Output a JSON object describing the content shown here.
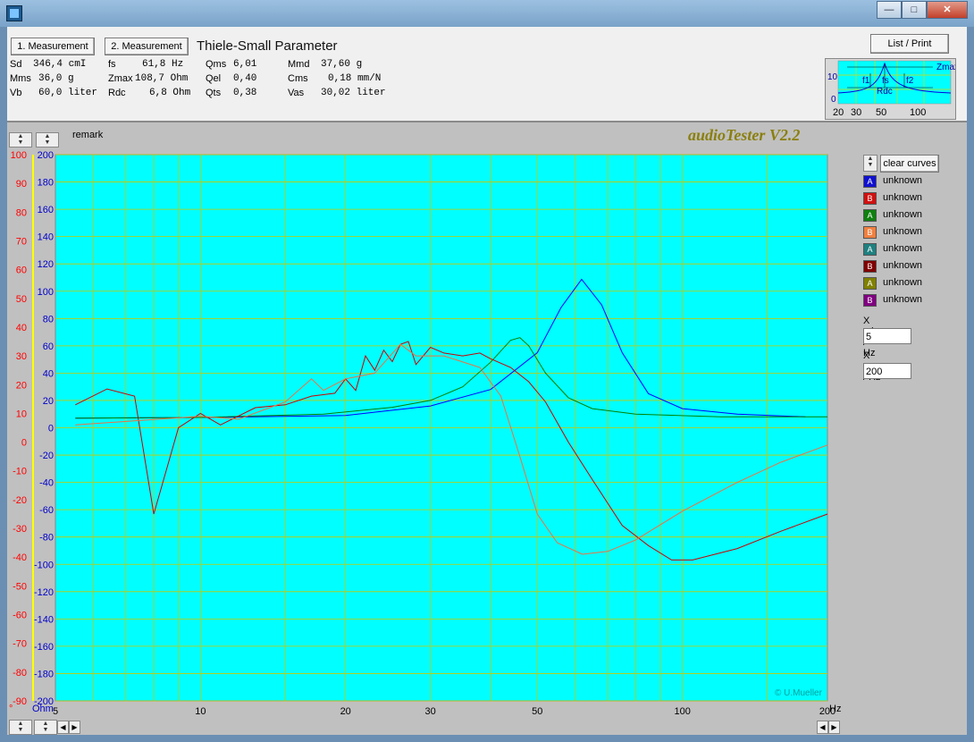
{
  "toolbar": {
    "meas1": "1. Measurement",
    "meas2": "2. Measurement",
    "list_print": "List / Print"
  },
  "tsp_title": "Thiele-Small Parameter",
  "params": [
    {
      "label": "Sd",
      "value": "346,4 cmI"
    },
    {
      "label": "Mms",
      "value": "36,0 g"
    },
    {
      "label": "Vb",
      "value": "60,0 liter"
    },
    {
      "label": "fs",
      "value": "61,8 Hz"
    },
    {
      "label": "Zmax",
      "value": "108,7 Ohm"
    },
    {
      "label": "Rdc",
      "value": "6,8 Ohm"
    },
    {
      "label": "Qms",
      "value": "6,01"
    },
    {
      "label": "Qel",
      "value": "0,40"
    },
    {
      "label": "Qts",
      "value": "0,38"
    },
    {
      "label": "Mmd",
      "value": "37,60 g"
    },
    {
      "label": "Cms",
      "value": "0,18 mm/N"
    },
    {
      "label": "Vas",
      "value": "30,02 liter"
    }
  ],
  "mini_chart": {
    "labels": [
      "Zmax",
      "f1",
      "fs",
      "f2",
      "Rdc"
    ],
    "y_ticks": [
      "10",
      "0"
    ],
    "x_ticks": [
      "20",
      "30",
      "50",
      "100"
    ]
  },
  "remark": "remark",
  "brand": "audioTester V2.2",
  "copyright": "© U.Mueller",
  "clear_curves": "clear curves",
  "legend": [
    {
      "tag": "A",
      "name": "unknown",
      "color": "#1010d0"
    },
    {
      "tag": "B",
      "name": "unknown",
      "color": "#d01010"
    },
    {
      "tag": "A",
      "name": "unknown",
      "color": "#108010"
    },
    {
      "tag": "B",
      "name": "unknown",
      "color": "#f08040"
    },
    {
      "tag": "A",
      "name": "unknown",
      "color": "#208080"
    },
    {
      "tag": "B",
      "name": "unknown",
      "color": "#800000"
    },
    {
      "tag": "A",
      "name": "unknown",
      "color": "#808000"
    },
    {
      "tag": "B",
      "name": "unknown",
      "color": "#800080"
    }
  ],
  "xmin": {
    "label": "X min / Hz",
    "value": "5"
  },
  "xmax": {
    "label": "X max / Hz",
    "value": "200"
  },
  "chart_data": {
    "type": "line",
    "x_scale": "log",
    "xlim": [
      5,
      200
    ],
    "x_ticks": [
      5,
      10,
      20,
      30,
      50,
      100,
      200
    ],
    "x_unit": "Hz",
    "left_axis": {
      "ylim": [
        -90,
        100
      ],
      "ticks": [
        100,
        90,
        80,
        70,
        60,
        50,
        40,
        30,
        20,
        10,
        0,
        -10,
        -20,
        -30,
        -40,
        -50,
        -60,
        -70,
        -80,
        -90
      ],
      "color": "#ff0000",
      "label": "°"
    },
    "right_axis": {
      "ylim": [
        -200,
        200
      ],
      "ticks": [
        200,
        180,
        160,
        140,
        120,
        100,
        80,
        60,
        40,
        20,
        0,
        -20,
        -40,
        -60,
        -80,
        -100,
        -120,
        -140,
        -160,
        -180,
        -200
      ],
      "color": "#0000c8",
      "label": "Ohm"
    },
    "grid": true,
    "background": "#00ffff",
    "series": [
      {
        "color": "#0000ff",
        "axis": "right",
        "points": [
          [
            5.5,
            7
          ],
          [
            10,
            7.5
          ],
          [
            20,
            9
          ],
          [
            30,
            16
          ],
          [
            40,
            28
          ],
          [
            50,
            55
          ],
          [
            56,
            88
          ],
          [
            61.8,
            108.7
          ],
          [
            68,
            90
          ],
          [
            75,
            55
          ],
          [
            85,
            25
          ],
          [
            100,
            14
          ],
          [
            130,
            10
          ],
          [
            180,
            8
          ]
        ]
      },
      {
        "color": "#008000",
        "axis": "right",
        "points": [
          [
            5.5,
            7
          ],
          [
            10,
            7.5
          ],
          [
            18,
            10
          ],
          [
            25,
            15
          ],
          [
            30,
            20
          ],
          [
            35,
            30
          ],
          [
            40,
            48
          ],
          [
            44,
            64
          ],
          [
            46,
            66
          ],
          [
            48,
            60
          ],
          [
            52,
            40
          ],
          [
            58,
            22
          ],
          [
            65,
            14
          ],
          [
            80,
            10
          ],
          [
            120,
            8
          ],
          [
            200,
            8
          ]
        ]
      },
      {
        "color": "#cc0000",
        "axis": "left",
        "points": [
          [
            5.5,
            13
          ],
          [
            6.4,
            18.5
          ],
          [
            7.3,
            16
          ],
          [
            8,
            -25
          ],
          [
            9,
            5
          ],
          [
            10,
            10
          ],
          [
            11,
            6
          ],
          [
            13,
            12
          ],
          [
            15,
            13
          ],
          [
            17,
            16
          ],
          [
            19,
            17
          ],
          [
            20,
            22
          ],
          [
            21,
            18
          ],
          [
            22,
            30
          ],
          [
            23,
            25
          ],
          [
            24,
            32
          ],
          [
            25,
            28
          ],
          [
            26,
            34
          ],
          [
            27,
            35
          ],
          [
            28,
            27
          ],
          [
            30,
            33
          ],
          [
            32,
            31
          ],
          [
            35,
            30
          ],
          [
            38,
            31
          ],
          [
            40,
            29
          ],
          [
            44,
            26
          ],
          [
            48,
            21
          ],
          [
            52,
            14
          ],
          [
            58,
            0
          ],
          [
            65,
            -13
          ],
          [
            75,
            -29
          ],
          [
            85,
            -36
          ],
          [
            95,
            -41
          ],
          [
            105,
            -41
          ],
          [
            130,
            -37
          ],
          [
            160,
            -31
          ],
          [
            200,
            -25
          ]
        ]
      },
      {
        "color": "#f07040",
        "axis": "left",
        "points": [
          [
            5.5,
            6
          ],
          [
            10,
            9
          ],
          [
            12,
            8
          ],
          [
            15,
            14
          ],
          [
            17,
            22
          ],
          [
            18,
            18
          ],
          [
            20,
            22
          ],
          [
            23,
            24
          ],
          [
            26,
            34
          ],
          [
            28,
            30
          ],
          [
            32,
            30
          ],
          [
            38,
            26
          ],
          [
            42,
            16
          ],
          [
            46,
            -5
          ],
          [
            50,
            -25
          ],
          [
            55,
            -35
          ],
          [
            62,
            -39
          ],
          [
            70,
            -38
          ],
          [
            80,
            -34
          ],
          [
            100,
            -24
          ],
          [
            130,
            -14
          ],
          [
            160,
            -7
          ],
          [
            200,
            -1
          ]
        ]
      }
    ]
  }
}
